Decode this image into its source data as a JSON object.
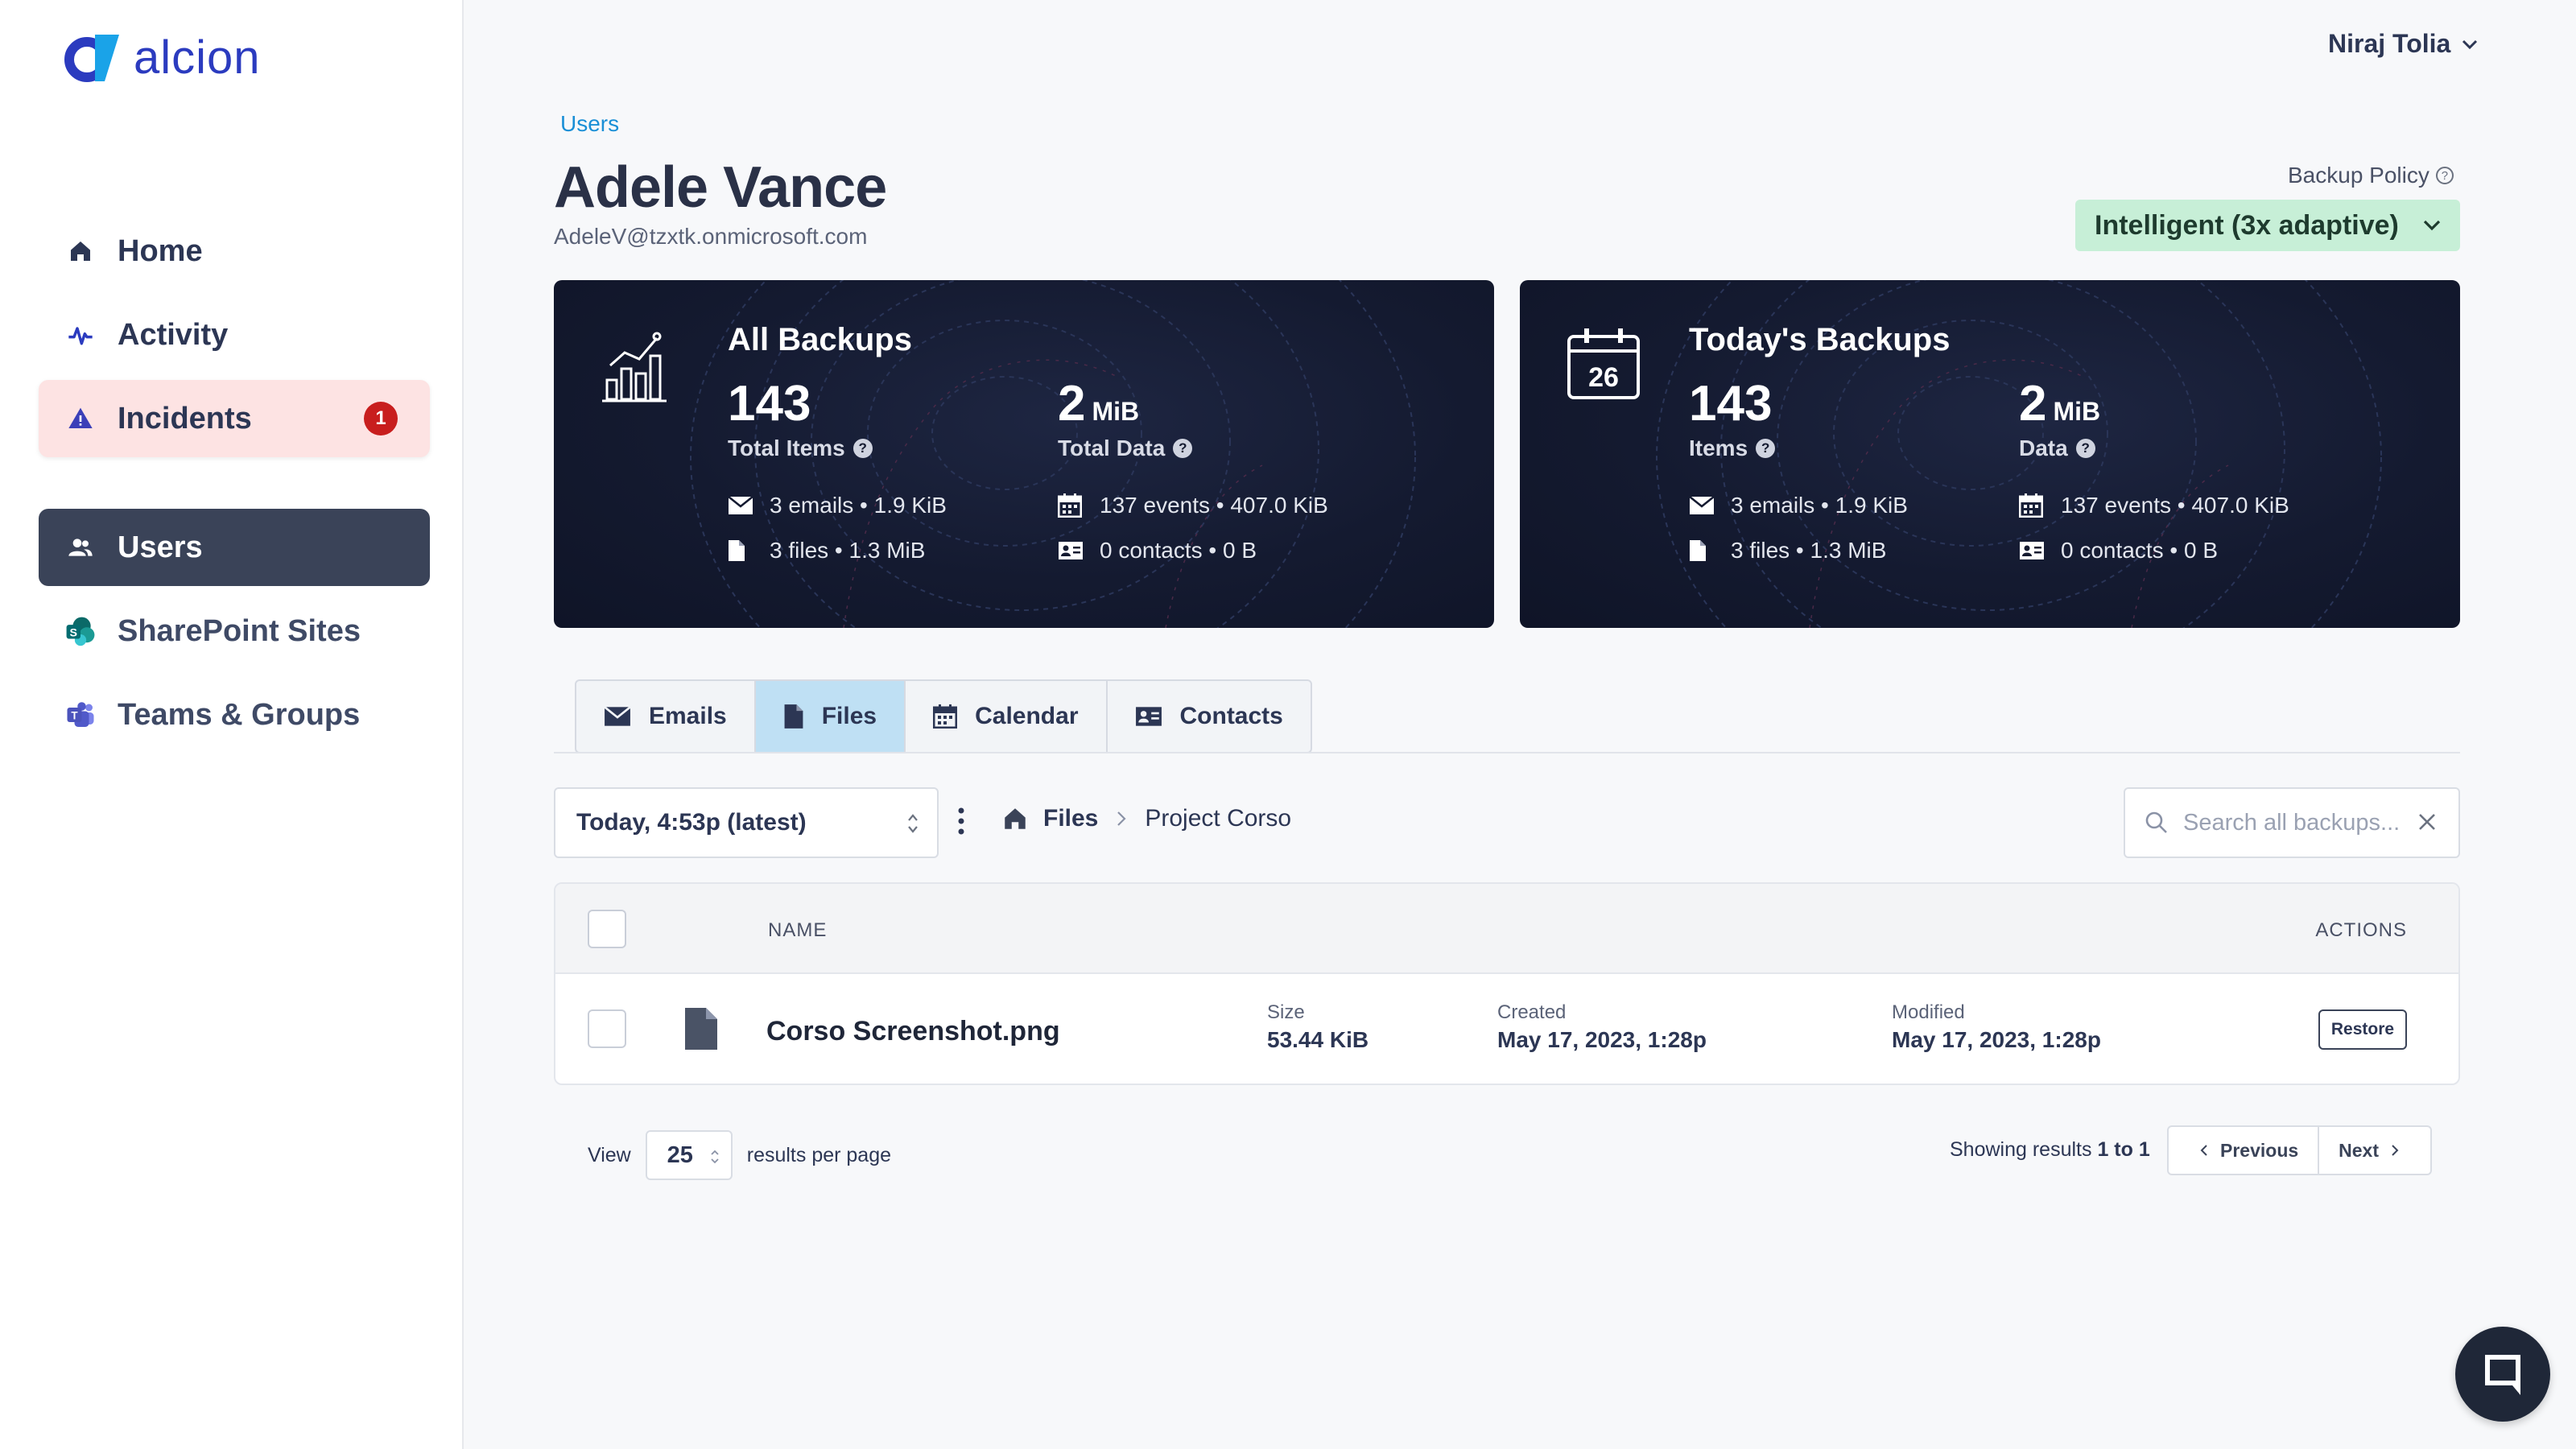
{
  "brand": {
    "name": "alcion"
  },
  "sidebar": {
    "items": [
      {
        "label": "Home",
        "icon": "home-icon"
      },
      {
        "label": "Activity",
        "icon": "activity-icon"
      },
      {
        "label": "Incidents",
        "icon": "warning-icon",
        "badge": "1"
      },
      {
        "label": "Users",
        "icon": "users-icon",
        "active": true
      },
      {
        "label": "SharePoint Sites",
        "icon": "sharepoint-icon"
      },
      {
        "label": "Teams & Groups",
        "icon": "teams-icon"
      }
    ]
  },
  "header": {
    "user_name": "Niraj Tolia",
    "breadcrumb": "Users",
    "title": "Adele Vance",
    "email": "AdeleV@tzxtk.onmicrosoft.com",
    "policy_label": "Backup Policy",
    "policy_value": "Intelligent (3x adaptive)"
  },
  "cards": [
    {
      "title": "All Backups",
      "items_value": "143",
      "items_label": "Total Items",
      "data_value": "2",
      "data_unit": "MiB",
      "data_label": "Total Data",
      "emails": "3 emails • 1.9 KiB",
      "files": "3 files • 1.3 MiB",
      "events": "137 events • 407.0 KiB",
      "contacts": "0 contacts • 0 B"
    },
    {
      "title": "Today's Backups",
      "calendar_day": "26",
      "items_value": "143",
      "items_label": "Items",
      "data_value": "2",
      "data_unit": "MiB",
      "data_label": "Data",
      "emails": "3 emails • 1.9 KiB",
      "files": "3 files • 1.3 MiB",
      "events": "137 events • 407.0 KiB",
      "contacts": "0 contacts • 0 B"
    }
  ],
  "tabs": [
    {
      "label": "Emails",
      "icon": "envelope-icon"
    },
    {
      "label": "Files",
      "icon": "file-icon",
      "selected": true
    },
    {
      "label": "Calendar",
      "icon": "calendar-icon"
    },
    {
      "label": "Contacts",
      "icon": "contact-card-icon"
    }
  ],
  "toolbar": {
    "snapshot": "Today, 4:53p (latest)",
    "path_root": "Files",
    "path_current": "Project Corso",
    "search_placeholder": "Search all backups..."
  },
  "table": {
    "columns": {
      "name": "NAME",
      "actions": "ACTIONS"
    },
    "rows": [
      {
        "name": "Corso Screenshot.png",
        "size_label": "Size",
        "size": "53.44 KiB",
        "created_label": "Created",
        "created": "May 17, 2023, 1:28p",
        "modified_label": "Modified",
        "modified": "May 17, 2023, 1:28p",
        "action": "Restore"
      }
    ]
  },
  "pagination": {
    "view_label": "View",
    "per_page": "25",
    "per_page_label": "results per page",
    "showing_prefix": "Showing results",
    "showing_range": "1 to 1",
    "previous": "Previous",
    "next": "Next"
  },
  "colors": {
    "brand": "#2b3bbf",
    "link": "#1a8fd6",
    "sidebar_active": "#3a4358",
    "incident_bg": "#fde3e3",
    "policy_bg": "#c7efd7",
    "card_bg": "#141a30",
    "tab_selected": "#bfe0f4"
  }
}
